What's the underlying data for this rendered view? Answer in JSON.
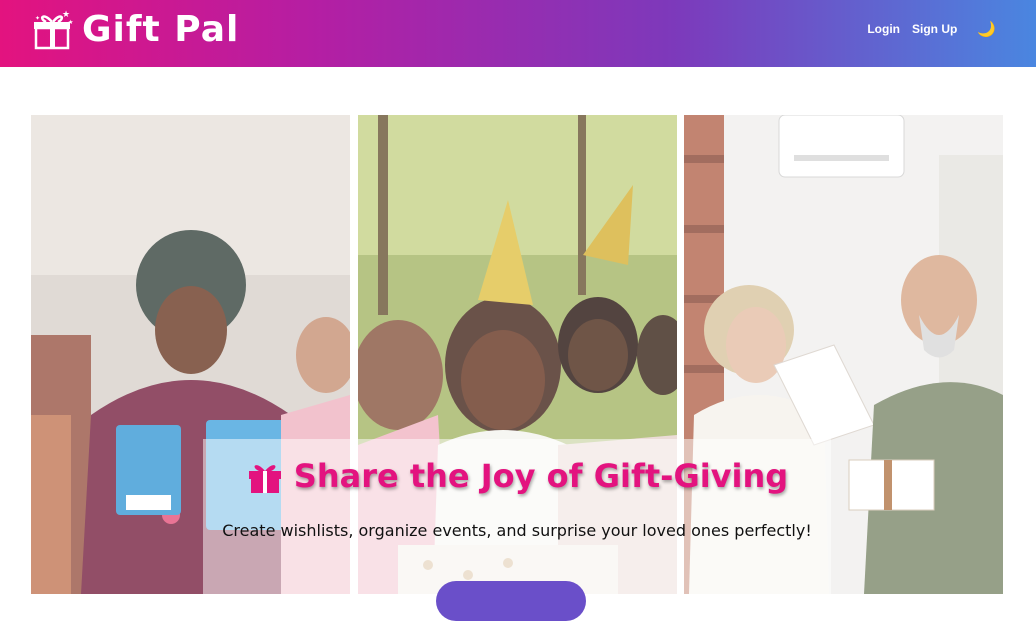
{
  "header": {
    "brand_name": "Gift Pal",
    "nav": {
      "login": "Login",
      "signup": "Sign Up"
    },
    "theme_toggle_icon": "moon-icon",
    "theme_toggle_glyph": "🌙"
  },
  "hero": {
    "title": "Share the Joy of Gift-Giving",
    "subtitle": "Create wishlists, organize events, and surprise your loved ones perfectly!",
    "title_icon": "gift-icon"
  },
  "colors": {
    "gradient_start": "#e3137f",
    "gradient_end": "#4a86e0",
    "title_pink": "#e3137f",
    "cta_purple": "#6a4fc9"
  }
}
